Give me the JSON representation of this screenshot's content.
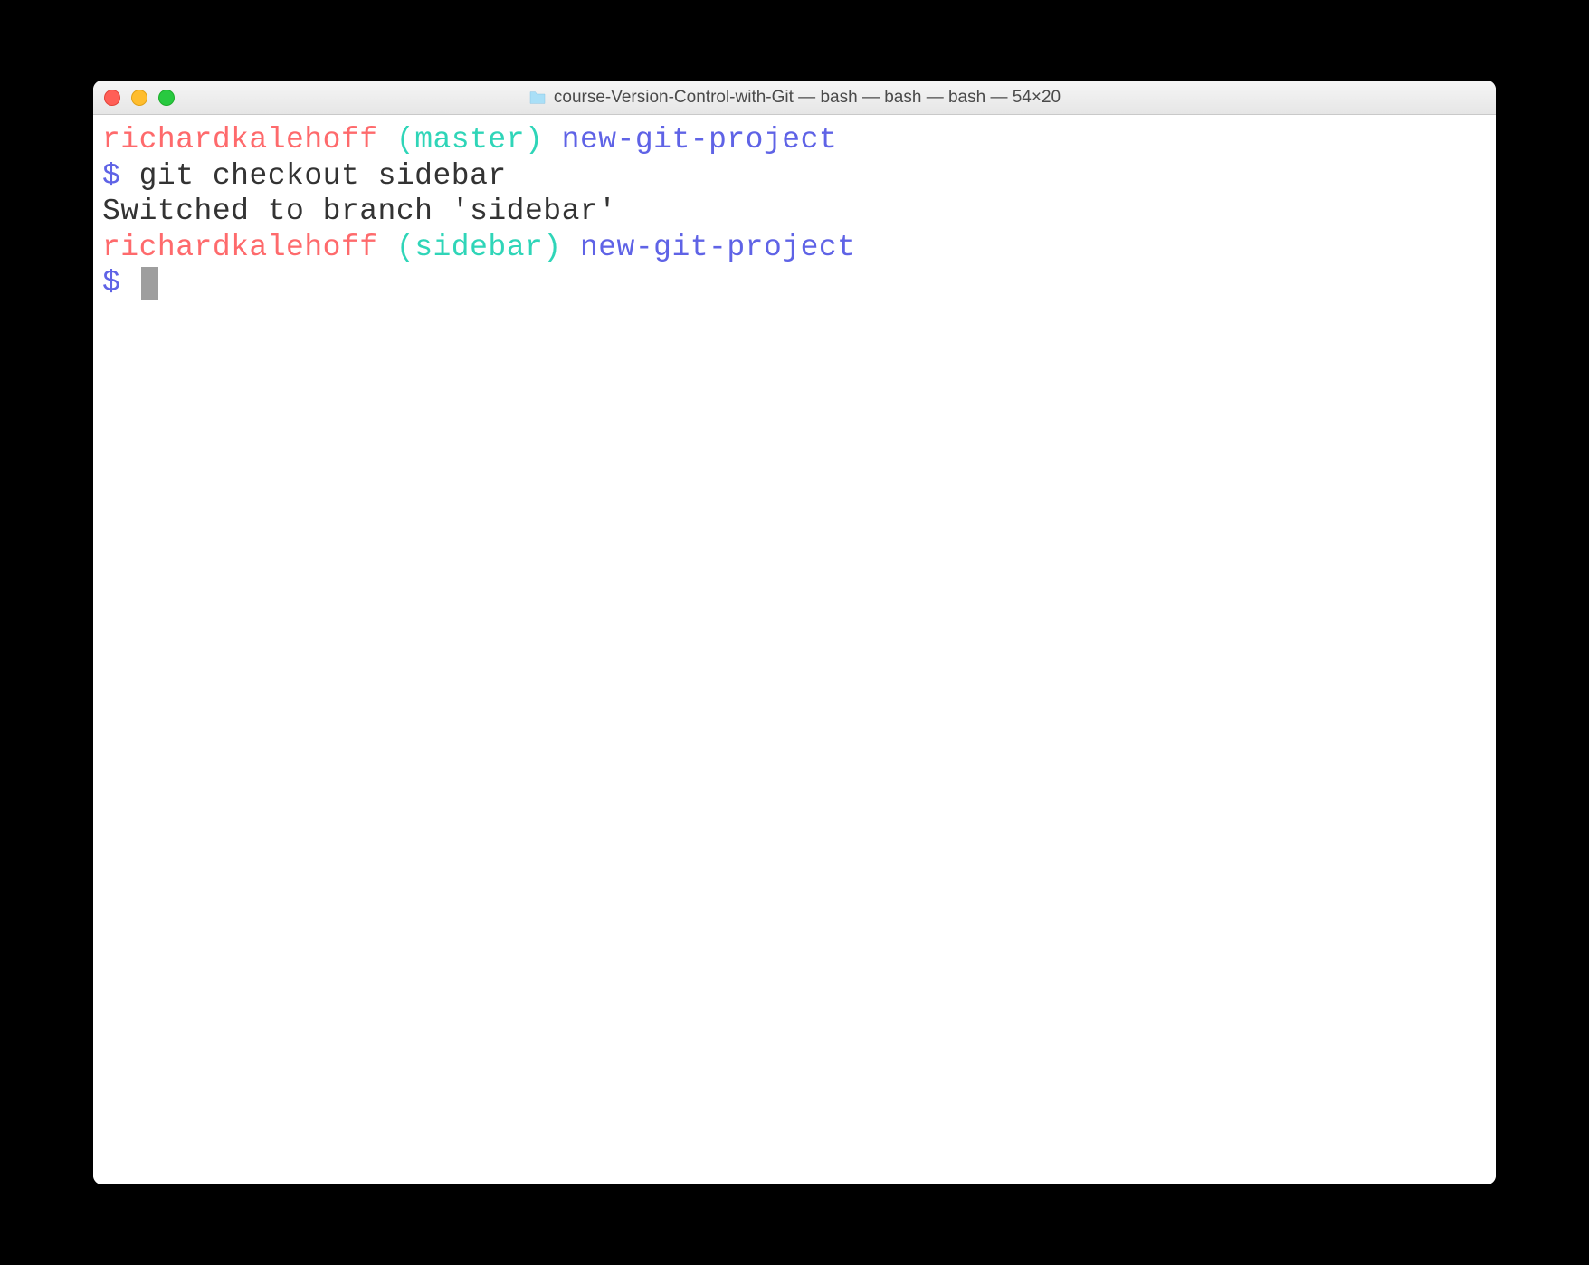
{
  "window": {
    "title": "course-Version-Control-with-Git — bash — bash — bash — 54×20"
  },
  "terminal": {
    "lines": [
      {
        "type": "prompt",
        "user": "richardkalehoff",
        "branch": "master",
        "dir": "new-git-project"
      },
      {
        "type": "command",
        "prompt": "$",
        "text": "git checkout sidebar"
      },
      {
        "type": "output",
        "text": "Switched to branch 'sidebar'"
      },
      {
        "type": "prompt",
        "user": "richardkalehoff",
        "branch": "sidebar",
        "dir": "new-git-project"
      },
      {
        "type": "command-cursor",
        "prompt": "$"
      }
    ]
  }
}
